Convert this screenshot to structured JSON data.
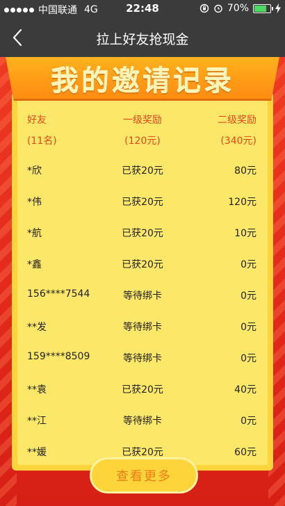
{
  "status_bar": {
    "carrier": "中国联通",
    "network": "4G",
    "time": "22:48",
    "battery": "70%"
  },
  "nav": {
    "title": "拉上好友抢现金"
  },
  "banner": {
    "title": "我的邀请记录"
  },
  "table": {
    "headers": [
      {
        "label": "好友",
        "sub": "(11名)"
      },
      {
        "label": "一级奖励",
        "sub": "(120元)"
      },
      {
        "label": "二级奖励",
        "sub": "(340元)"
      }
    ],
    "rows": [
      {
        "name": "*欣",
        "level1": "已获20元",
        "level2": "80元"
      },
      {
        "name": "*伟",
        "level1": "已获20元",
        "level2": "120元"
      },
      {
        "name": "*航",
        "level1": "已获20元",
        "level2": "10元"
      },
      {
        "name": "*鑫",
        "level1": "已获20元",
        "level2": "0元"
      },
      {
        "name": "156****7544",
        "level1": "等待绑卡",
        "level2": "0元"
      },
      {
        "name": "**发",
        "level1": "等待绑卡",
        "level2": "0元"
      },
      {
        "name": "159****8509",
        "level1": "等待绑卡",
        "level2": "0元"
      },
      {
        "name": "**袁",
        "level1": "已获20元",
        "level2": "40元"
      },
      {
        "name": "**江",
        "level1": "等待绑卡",
        "level2": "0元"
      },
      {
        "name": "**媛",
        "level1": "已获20元",
        "level2": "60元"
      }
    ]
  },
  "more_button": {
    "label": "查看更多"
  },
  "colors": {
    "accent": "#e8481e",
    "background": "#d9261c",
    "card": "#fde768",
    "button_text": "#f47d16"
  },
  "icons": [
    "signal-dots",
    "back-chevron-icon",
    "rotation-lock-icon",
    "alarm-icon",
    "battery-icon",
    "charging-icon"
  ]
}
